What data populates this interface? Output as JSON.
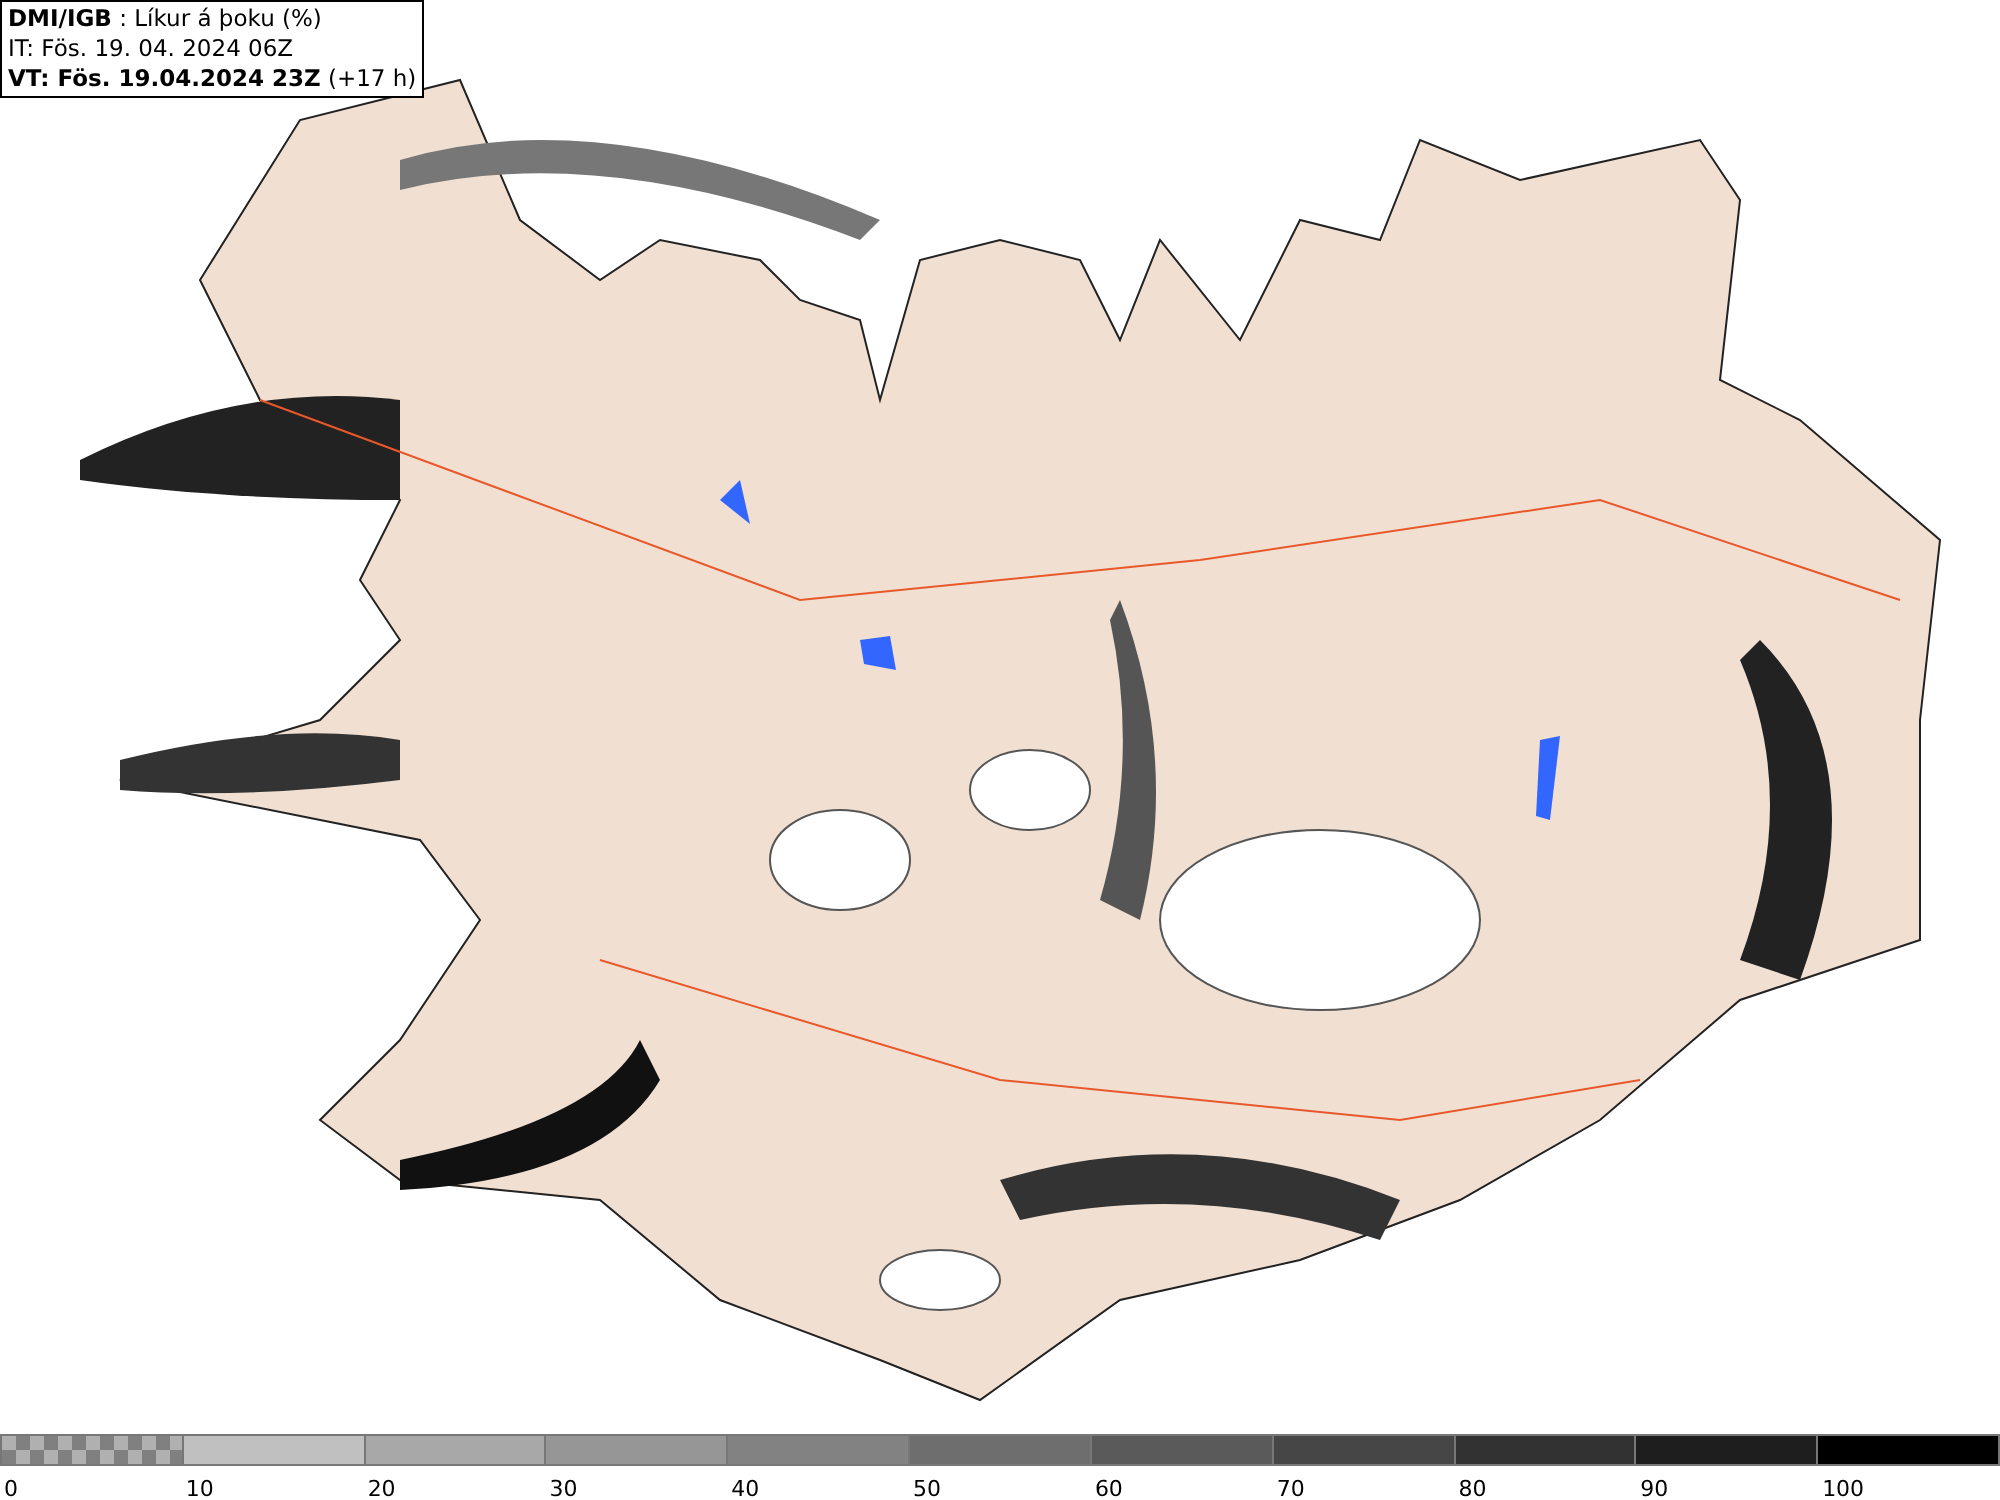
{
  "header": {
    "lines": [
      "**DMI/IGB** : Líkur á þoku (%)",
      "IT: Fös. 19. 04. 2024 06Z",
      "**VT: Fös. 19.04.2024 23Z** (+17 h)"
    ]
  },
  "legend": {
    "segments": [
      {
        "kind": "checkered",
        "color": "#808080"
      },
      {
        "kind": "solid",
        "color": "#c0c0c0"
      },
      {
        "kind": "solid",
        "color": "#a8a8a8"
      },
      {
        "kind": "solid",
        "color": "#969696"
      },
      {
        "kind": "solid",
        "color": "#828282"
      },
      {
        "kind": "solid",
        "color": "#6e6e6e"
      },
      {
        "kind": "solid",
        "color": "#5a5a5a"
      },
      {
        "kind": "solid",
        "color": "#464646"
      },
      {
        "kind": "solid",
        "color": "#323232"
      },
      {
        "kind": "solid",
        "color": "#1e1e1e"
      },
      {
        "kind": "solid",
        "color": "#000000"
      }
    ],
    "labels": [
      "0",
      "10",
      "20",
      "30",
      "40",
      "50",
      "60",
      "70",
      "80",
      "90",
      "100"
    ]
  }
}
